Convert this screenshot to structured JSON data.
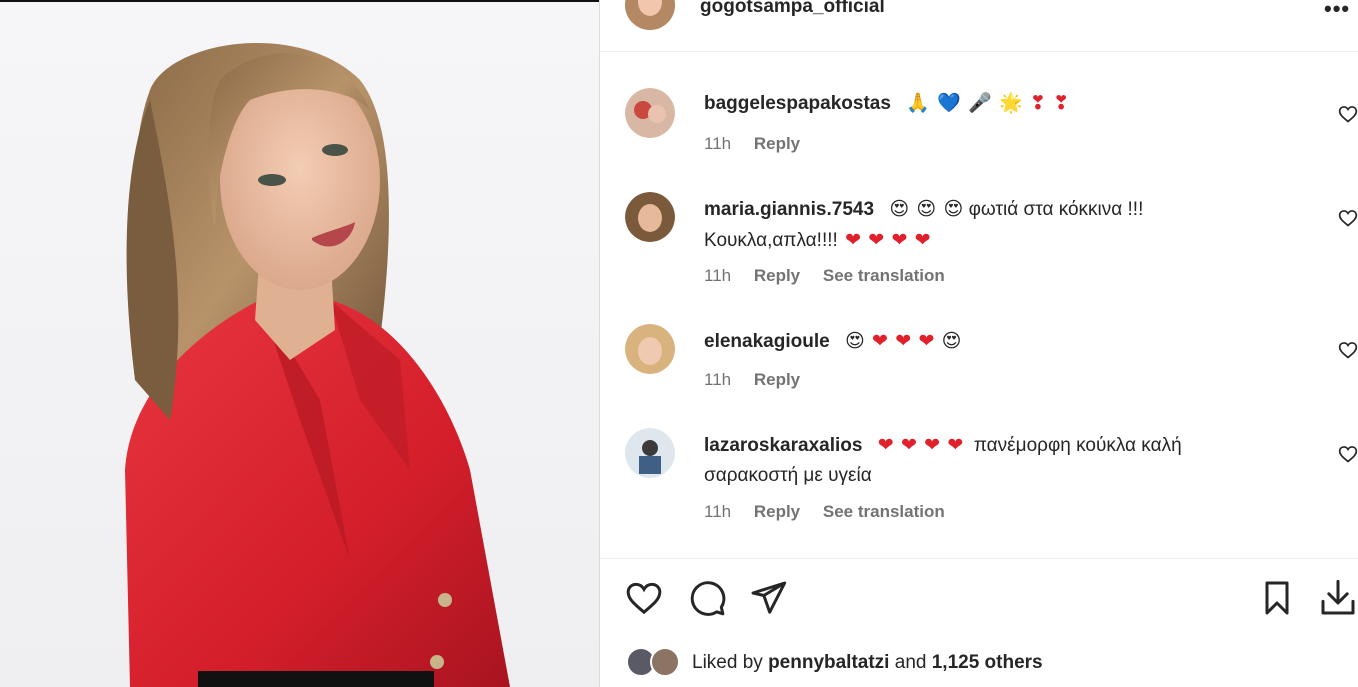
{
  "post": {
    "author": "gogotsampa_official",
    "more_icon": "•••"
  },
  "comments": [
    {
      "username": "baggelespapakostas",
      "text": "",
      "emojis": [
        "🙏",
        "💙",
        "🎤",
        "🌟",
        "❣",
        "❣"
      ],
      "time": "11h",
      "reply": "Reply",
      "translate": ""
    },
    {
      "username": "maria.giannis.7543",
      "text_line1_emojis": [
        "😍",
        "😍",
        "😍"
      ],
      "text_line1": "φωτιά στα κόκκινα !!!",
      "text_line2": "Κουκλα,απλα!!!!",
      "text_line2_emojis": [
        "❤",
        "❤",
        "❤",
        "❤"
      ],
      "time": "11h",
      "reply": "Reply",
      "translate": "See translation"
    },
    {
      "username": "elenakagioule",
      "emojis": [
        "😍",
        "❤",
        "❤",
        "❤",
        "😍"
      ],
      "time": "11h",
      "reply": "Reply",
      "translate": ""
    },
    {
      "username": "lazaroskaraxalios",
      "emojis": [
        "❤",
        "❤",
        "❤",
        "❤"
      ],
      "text_line1": "πανέμορφη κούκλα καλή",
      "text_line2": "σαρακοστή με υγεία",
      "time": "11h",
      "reply": "Reply",
      "translate": "See translation"
    }
  ],
  "likes": {
    "prefix": "Liked by",
    "user": "pennybaltatzi",
    "joiner": "and",
    "others": "1,125 others"
  },
  "colors": {
    "text": "#262626",
    "secondary": "#737373",
    "heart": "#e0202b",
    "jacket": "#d8242f"
  },
  "icons": [
    "heart-icon",
    "comment-icon",
    "share-icon",
    "bookmark-icon",
    "download-icon",
    "more-icon"
  ]
}
